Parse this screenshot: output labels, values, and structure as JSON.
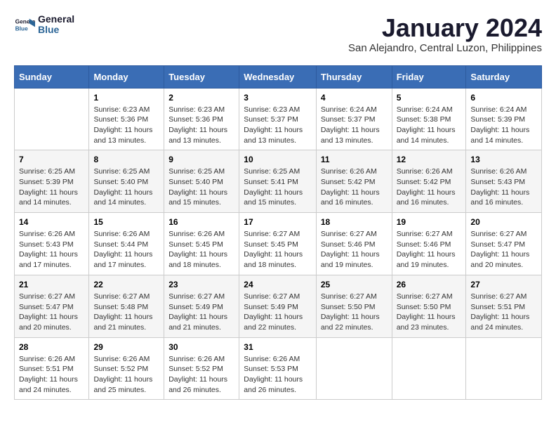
{
  "logo": {
    "line1": "General",
    "line2": "Blue"
  },
  "title": "January 2024",
  "subtitle": "San Alejandro, Central Luzon, Philippines",
  "days_of_week": [
    "Sunday",
    "Monday",
    "Tuesday",
    "Wednesday",
    "Thursday",
    "Friday",
    "Saturday"
  ],
  "weeks": [
    [
      {
        "day": "",
        "info": ""
      },
      {
        "day": "1",
        "info": "Sunrise: 6:23 AM\nSunset: 5:36 PM\nDaylight: 11 hours\nand 13 minutes."
      },
      {
        "day": "2",
        "info": "Sunrise: 6:23 AM\nSunset: 5:36 PM\nDaylight: 11 hours\nand 13 minutes."
      },
      {
        "day": "3",
        "info": "Sunrise: 6:23 AM\nSunset: 5:37 PM\nDaylight: 11 hours\nand 13 minutes."
      },
      {
        "day": "4",
        "info": "Sunrise: 6:24 AM\nSunset: 5:37 PM\nDaylight: 11 hours\nand 13 minutes."
      },
      {
        "day": "5",
        "info": "Sunrise: 6:24 AM\nSunset: 5:38 PM\nDaylight: 11 hours\nand 14 minutes."
      },
      {
        "day": "6",
        "info": "Sunrise: 6:24 AM\nSunset: 5:39 PM\nDaylight: 11 hours\nand 14 minutes."
      }
    ],
    [
      {
        "day": "7",
        "info": "Sunrise: 6:25 AM\nSunset: 5:39 PM\nDaylight: 11 hours\nand 14 minutes."
      },
      {
        "day": "8",
        "info": "Sunrise: 6:25 AM\nSunset: 5:40 PM\nDaylight: 11 hours\nand 14 minutes."
      },
      {
        "day": "9",
        "info": "Sunrise: 6:25 AM\nSunset: 5:40 PM\nDaylight: 11 hours\nand 15 minutes."
      },
      {
        "day": "10",
        "info": "Sunrise: 6:25 AM\nSunset: 5:41 PM\nDaylight: 11 hours\nand 15 minutes."
      },
      {
        "day": "11",
        "info": "Sunrise: 6:26 AM\nSunset: 5:42 PM\nDaylight: 11 hours\nand 16 minutes."
      },
      {
        "day": "12",
        "info": "Sunrise: 6:26 AM\nSunset: 5:42 PM\nDaylight: 11 hours\nand 16 minutes."
      },
      {
        "day": "13",
        "info": "Sunrise: 6:26 AM\nSunset: 5:43 PM\nDaylight: 11 hours\nand 16 minutes."
      }
    ],
    [
      {
        "day": "14",
        "info": "Sunrise: 6:26 AM\nSunset: 5:43 PM\nDaylight: 11 hours\nand 17 minutes."
      },
      {
        "day": "15",
        "info": "Sunrise: 6:26 AM\nSunset: 5:44 PM\nDaylight: 11 hours\nand 17 minutes."
      },
      {
        "day": "16",
        "info": "Sunrise: 6:26 AM\nSunset: 5:45 PM\nDaylight: 11 hours\nand 18 minutes."
      },
      {
        "day": "17",
        "info": "Sunrise: 6:27 AM\nSunset: 5:45 PM\nDaylight: 11 hours\nand 18 minutes."
      },
      {
        "day": "18",
        "info": "Sunrise: 6:27 AM\nSunset: 5:46 PM\nDaylight: 11 hours\nand 19 minutes."
      },
      {
        "day": "19",
        "info": "Sunrise: 6:27 AM\nSunset: 5:46 PM\nDaylight: 11 hours\nand 19 minutes."
      },
      {
        "day": "20",
        "info": "Sunrise: 6:27 AM\nSunset: 5:47 PM\nDaylight: 11 hours\nand 20 minutes."
      }
    ],
    [
      {
        "day": "21",
        "info": "Sunrise: 6:27 AM\nSunset: 5:47 PM\nDaylight: 11 hours\nand 20 minutes."
      },
      {
        "day": "22",
        "info": "Sunrise: 6:27 AM\nSunset: 5:48 PM\nDaylight: 11 hours\nand 21 minutes."
      },
      {
        "day": "23",
        "info": "Sunrise: 6:27 AM\nSunset: 5:49 PM\nDaylight: 11 hours\nand 21 minutes."
      },
      {
        "day": "24",
        "info": "Sunrise: 6:27 AM\nSunset: 5:49 PM\nDaylight: 11 hours\nand 22 minutes."
      },
      {
        "day": "25",
        "info": "Sunrise: 6:27 AM\nSunset: 5:50 PM\nDaylight: 11 hours\nand 22 minutes."
      },
      {
        "day": "26",
        "info": "Sunrise: 6:27 AM\nSunset: 5:50 PM\nDaylight: 11 hours\nand 23 minutes."
      },
      {
        "day": "27",
        "info": "Sunrise: 6:27 AM\nSunset: 5:51 PM\nDaylight: 11 hours\nand 24 minutes."
      }
    ],
    [
      {
        "day": "28",
        "info": "Sunrise: 6:26 AM\nSunset: 5:51 PM\nDaylight: 11 hours\nand 24 minutes."
      },
      {
        "day": "29",
        "info": "Sunrise: 6:26 AM\nSunset: 5:52 PM\nDaylight: 11 hours\nand 25 minutes."
      },
      {
        "day": "30",
        "info": "Sunrise: 6:26 AM\nSunset: 5:52 PM\nDaylight: 11 hours\nand 26 minutes."
      },
      {
        "day": "31",
        "info": "Sunrise: 6:26 AM\nSunset: 5:53 PM\nDaylight: 11 hours\nand 26 minutes."
      },
      {
        "day": "",
        "info": ""
      },
      {
        "day": "",
        "info": ""
      },
      {
        "day": "",
        "info": ""
      }
    ]
  ]
}
